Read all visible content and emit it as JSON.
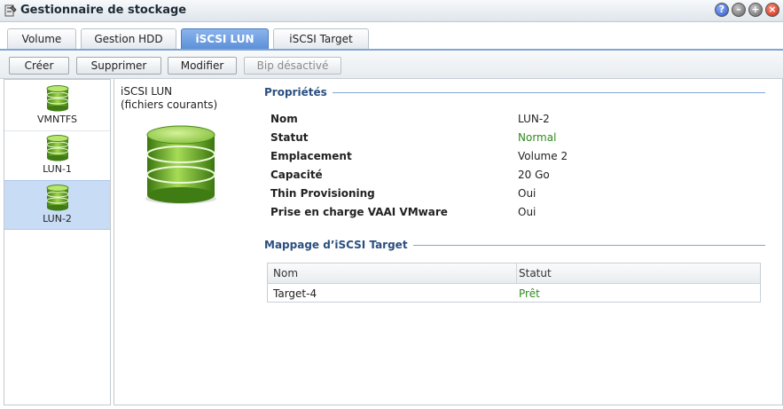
{
  "window": {
    "title": "Gestionnaire de stockage"
  },
  "tabs": [
    {
      "label": "Volume"
    },
    {
      "label": "Gestion HDD"
    },
    {
      "label": "iSCSI LUN"
    },
    {
      "label": "iSCSI Target"
    }
  ],
  "toolbar": {
    "create": "Créer",
    "delete": "Supprimer",
    "edit": "Modifier",
    "beep": "Bip désactivé"
  },
  "sidebar": {
    "items": [
      {
        "label": "VMNTFS"
      },
      {
        "label": "LUN-1"
      },
      {
        "label": "LUN-2"
      }
    ]
  },
  "detail": {
    "caption_line1": "iSCSI LUN",
    "caption_line2": "(fichiers courants)",
    "properties_title": "Propriétés",
    "properties": [
      {
        "label": "Nom",
        "value": "LUN-2"
      },
      {
        "label": "Statut",
        "value": "Normal"
      },
      {
        "label": "Emplacement",
        "value": "Volume 2"
      },
      {
        "label": "Capacité",
        "value": "20 Go"
      },
      {
        "label": "Thin Provisioning",
        "value": "Oui"
      },
      {
        "label": "Prise en charge VAAI VMware",
        "value": "Oui"
      }
    ],
    "mapping_title": "Mappage d’iSCSI Target",
    "mapping_columns": [
      "Nom",
      "Statut"
    ],
    "mapping_rows": [
      {
        "name": "Target-4",
        "status": "Prêt"
      }
    ]
  },
  "colors": {
    "status_ok": "#2e8b1e",
    "accent": "#5b8fd8"
  }
}
